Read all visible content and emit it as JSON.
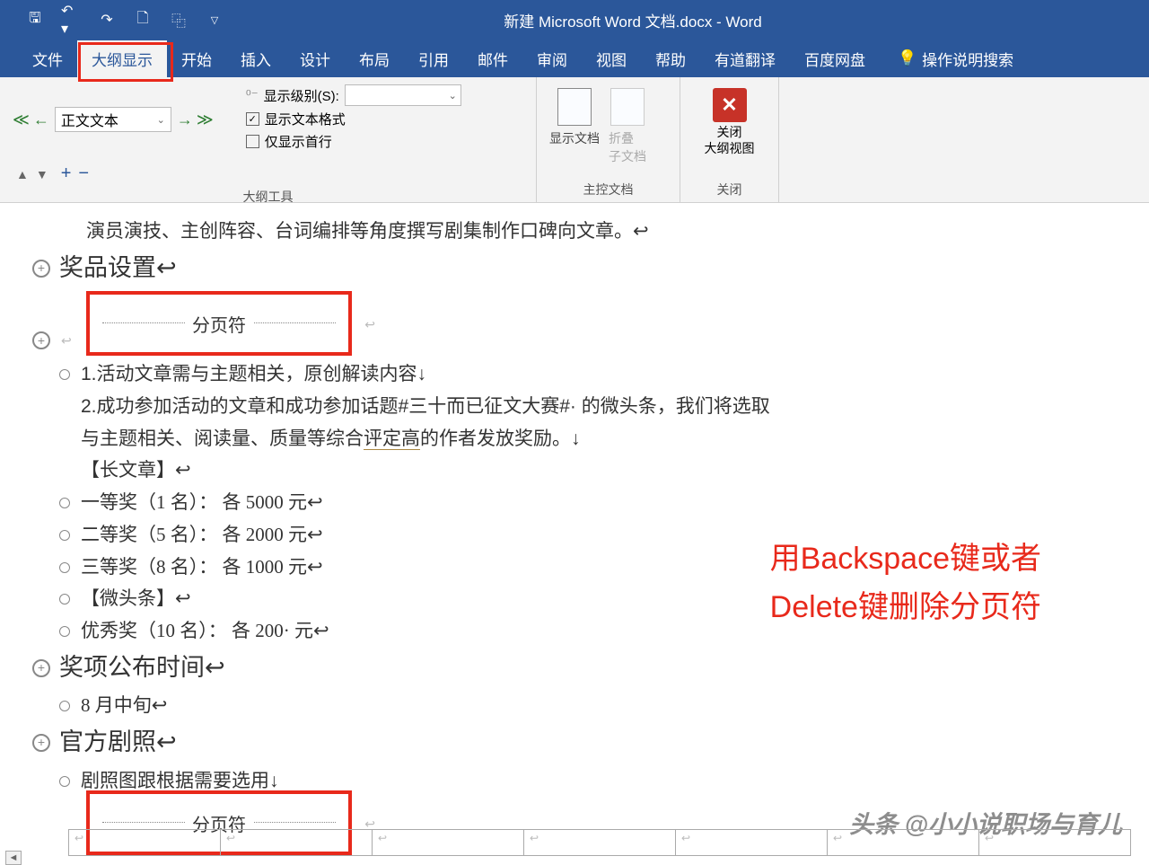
{
  "titlebar": {
    "document_title": "新建 Microsoft Word 文档.docx  -  Word"
  },
  "tabs": {
    "file": "文件",
    "outline": "大纲显示",
    "home": "开始",
    "insert": "插入",
    "design": "设计",
    "layout": "布局",
    "references": "引用",
    "mailings": "邮件",
    "review": "审阅",
    "view": "视图",
    "help": "帮助",
    "youdao": "有道翻译",
    "baidu": "百度网盘",
    "tell_me": "操作说明搜索"
  },
  "ribbon": {
    "level_value": "正文文本",
    "show_level_label": "显示级别(S):",
    "show_text_format": "显示文本格式",
    "first_line_only": "仅显示首行",
    "outline_tools": "大纲工具",
    "show_document": "显示文档",
    "collapse_sub": "折叠",
    "collapse_sub2": "子文档",
    "master_doc": "主控文档",
    "close_outline": "关闭",
    "close_outline2": "大纲视图",
    "close_group": "关闭"
  },
  "doc": {
    "line1": "演员演技、主创阵容、台词编排等角度撰写剧集制作口碑向文章。↩",
    "heading1": "奖品设置↩",
    "page_break": "分页符",
    "body1": "1.活动文章需与主题相关，原创解读内容↓",
    "body2a": "2.成功参加活动的文章和成功参加话题#三十而已征文大赛#· 的微头条，我们将选取与主题相关、阅读量、质量等综合",
    "body2_u": "评定高",
    "body2b": "的作者发放奖励。↓",
    "body3": "【长文章】↩",
    "body4": "一等奖（1 名）： 各 5000 元↩",
    "body5": "二等奖（5 名）： 各 2000 元↩",
    "body6": "三等奖（8 名）： 各 1000 元↩",
    "body7": "【微头条】↩",
    "body8": "优秀奖（10 名）： 各 200· 元↩",
    "heading2": "奖项公布时间↩",
    "body9": "8 月中旬↩",
    "heading3": "官方剧照↩",
    "body10a": "剧照",
    "body10u": "图跟根据",
    "body10b": "需要选用↓"
  },
  "annotation": {
    "line1": "用Backspace键或者",
    "line2": "Delete键删除分页符"
  },
  "watermark": "头条 @小小说职场与育儿"
}
